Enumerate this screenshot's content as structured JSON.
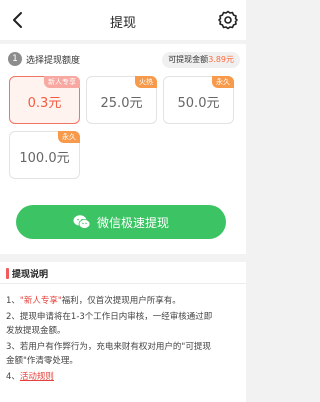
{
  "header": {
    "title": "提现",
    "back_icon": "chevron-left-icon",
    "settings_icon": "gear-icon"
  },
  "step": {
    "number": "1",
    "label": "选择提现额度",
    "balance_prefix": "可提现金额",
    "balance_amount": "3.89元"
  },
  "options": [
    {
      "value": "0.3元",
      "tag": "新人专享",
      "selected": true
    },
    {
      "value": "25.0元",
      "tag": "火热",
      "selected": false
    },
    {
      "value": "50.0元",
      "tag": "永久",
      "selected": false
    },
    {
      "value": "100.0元",
      "tag": "永久",
      "selected": false
    }
  ],
  "withdraw_button": {
    "label": "微信极速提现",
    "icon": "wechat-icon",
    "color": "#3cc464"
  },
  "info": {
    "title": "提现说明",
    "line1_prefix": "1、",
    "line1_highlight": "\"新人专享\"",
    "line1_rest": "福利，仅首次提现用户所享有。",
    "line2a": "2、提现申请将在1-3个工作日内审核，一经审核通过即",
    "line2b": "发放提现金额。",
    "line3a": "3、若用户有作弊行为，充电来财有权对用户的\"可提现",
    "line3b": "金额\"作清零处理。",
    "line4_prefix": "4、",
    "line4_link": "活动规则"
  },
  "colors": {
    "accent": "#f45a40",
    "wechat_green": "#3cc464",
    "rule_red": "#e5413a"
  }
}
